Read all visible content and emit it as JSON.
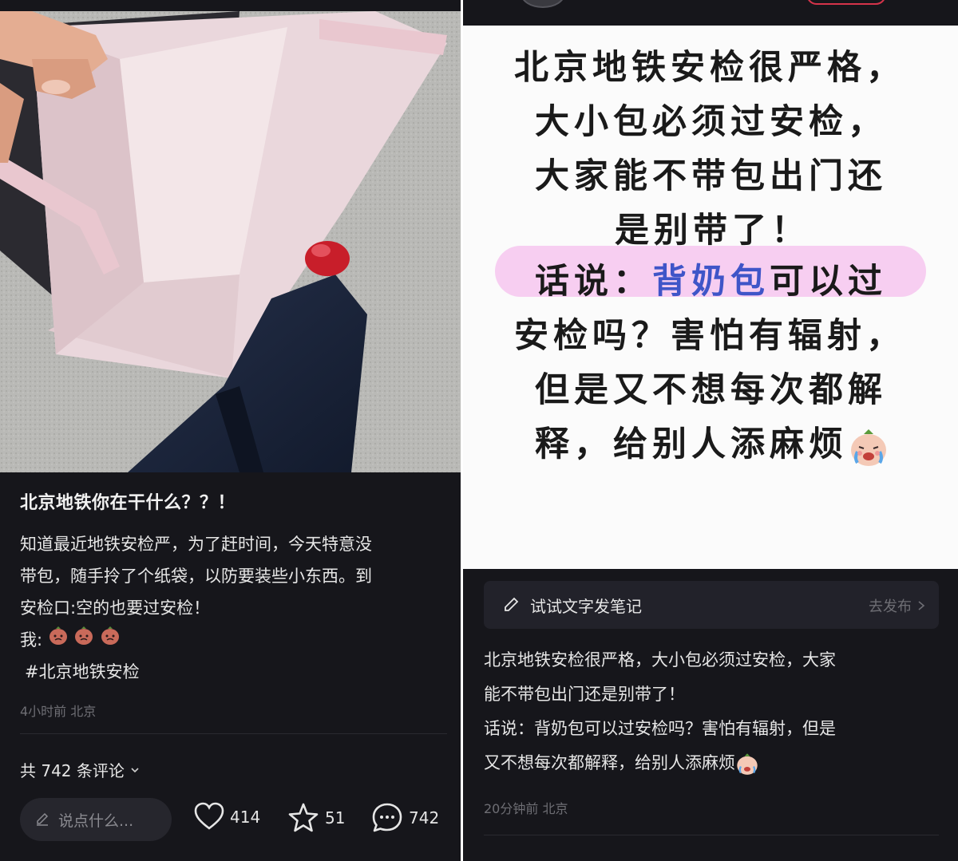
{
  "left": {
    "title": "北京地铁你在干什么？？！",
    "body_lines": [
      "知道最近地铁安检严，为了赶时间，今天特意没",
      "带包，随手拎了个纸袋，以防要装些小东西。到",
      "安检口:空的也要过安检！"
    ],
    "me_label": "我:",
    "hashtag": "#北京地铁安检",
    "meta": "4小时前 北京",
    "comments_count": "共 742 条评论",
    "input_placeholder": "说点什么...",
    "likes": "414",
    "favorites": "51",
    "comments": "742"
  },
  "right": {
    "note_lines": [
      "北京地铁安检很严格，",
      "大小包必须过安检，",
      "大家能不带包出门还",
      "是别带了！"
    ],
    "note_highlight_prefix": "话说：",
    "note_highlight_blue": "背奶包",
    "note_highlight_suffix": "可以过",
    "note_lines_after": [
      "安检吗？害怕有辐射，",
      "但是又不想每次都解",
      "释，给别人添麻烦"
    ],
    "try_label": "试试文字发笔记",
    "try_action": "去发布",
    "body_lines": [
      "北京地铁安检很严格，大小包必须过安检，大家",
      "能不带包出门还是别带了！",
      "话说：背奶包可以过安检吗？害怕有辐射，但是",
      "又不想每次都解释，给别人添麻烦"
    ],
    "meta": "20分钟前 北京"
  },
  "colors": {
    "background": "#16161b",
    "highlight": "#f6c6ef",
    "blue_text": "#3f55c8",
    "text": "#e6e6e6",
    "muted": "#6e6e74"
  },
  "icons": [
    "pencil-icon",
    "heart-icon",
    "star-icon",
    "comment-icon",
    "chevron-down-icon",
    "chevron-right-icon",
    "crying-face-emoji",
    "peach-face-emoji"
  ]
}
